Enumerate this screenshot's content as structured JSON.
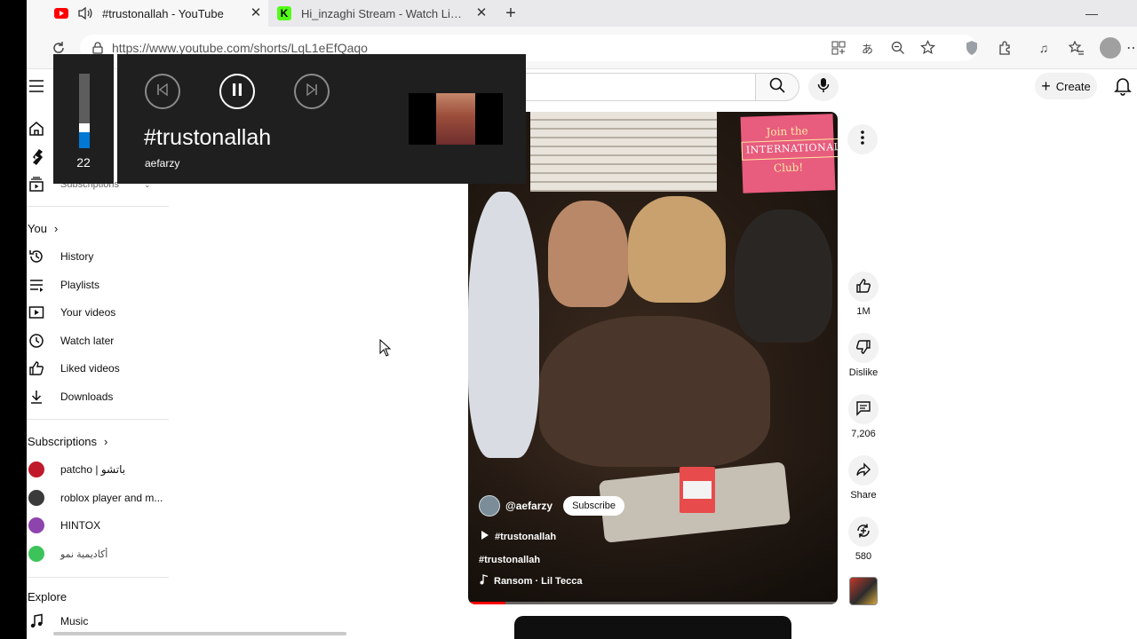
{
  "browser": {
    "tabs": [
      {
        "title": "#trustonallah - YouTube"
      },
      {
        "title": "Hi_inzaghi Stream - Watch Live on Kick"
      }
    ],
    "url": "https://www.youtube.com/shorts/LqL1eEfQaqo"
  },
  "youtube": {
    "create_label": "Create",
    "sidebar": {
      "subscriptions_top": "Subscriptions",
      "you_heading": "You",
      "you_items": [
        {
          "label": "History",
          "icon": "history-icon"
        },
        {
          "label": "Playlists",
          "icon": "playlists-icon"
        },
        {
          "label": "Your videos",
          "icon": "your-videos-icon"
        },
        {
          "label": "Watch later",
          "icon": "watch-later-icon"
        },
        {
          "label": "Liked videos",
          "icon": "liked-videos-icon"
        },
        {
          "label": "Downloads",
          "icon": "downloads-icon"
        }
      ],
      "subscriptions_heading": "Subscriptions",
      "subscriptions": [
        {
          "label": "patcho | باتشو",
          "color": "#c0192b"
        },
        {
          "label": "roblox player and m...",
          "color": "#3a3a3a"
        },
        {
          "label": "HINTOX",
          "color": "#8e44ad"
        },
        {
          "label": "أكاديمية نمو",
          "color": "#3cc35a"
        }
      ],
      "explore_heading": "Explore",
      "explore_items": [
        {
          "label": "Music",
          "icon": "music-icon"
        }
      ]
    },
    "short": {
      "poster_line1": "Join the",
      "poster_line2": "INTERNATIONAL",
      "poster_line3": "Club!",
      "channel": "@aefarzy",
      "subscribe_label": "Subscribe",
      "playlist_tag": "#trustonallah",
      "title": "#trustonallah",
      "sound": "Ransom · Lil Tecca",
      "progress_fraction": 0.1
    },
    "actions": {
      "likes": "1M",
      "dislike_label": "Dislike",
      "comments": "7,206",
      "share_label": "Share",
      "remix": "580"
    }
  },
  "media_overlay": {
    "volume": "22",
    "volume_fraction": 0.22,
    "title": "#trustonallah",
    "artist": "aefarzy"
  },
  "colors": {
    "youtube_red": "#ff0000",
    "overlay_bg": "#1f1f1f",
    "volume_accent": "#0078d4"
  }
}
